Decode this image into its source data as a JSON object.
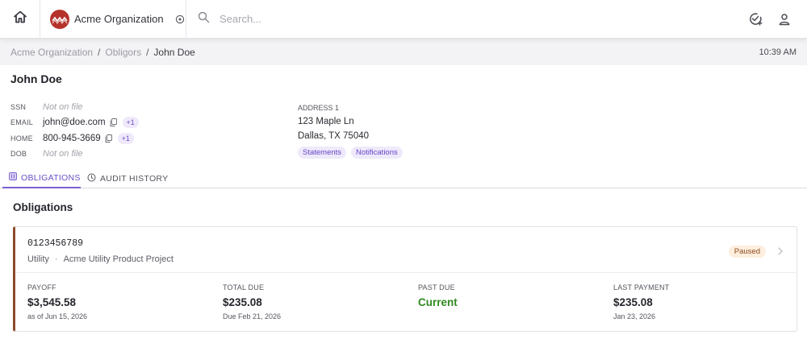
{
  "header": {
    "org_name": "Acme Organization",
    "search_placeholder": "Search...",
    "icons": {
      "home": "home-icon",
      "org_logo": "acme-logo",
      "org_switch": "switch-org-icon",
      "search": "search-icon",
      "tasks": "check-plus-icon",
      "user": "user-icon"
    }
  },
  "breadcrumb": {
    "items": [
      "Acme Organization",
      "Obligors"
    ],
    "current": "John Doe",
    "separator": "/"
  },
  "clock": "10:39 AM",
  "person": {
    "name": "John Doe",
    "ssn": {
      "label": "SSN",
      "value": "Not on file"
    },
    "email": {
      "label": "EMAIL",
      "value": "john@doe.com",
      "extra": "+1"
    },
    "home": {
      "label": "HOME",
      "value": "800-945-3669",
      "extra": "+1"
    },
    "dob": {
      "label": "DOB",
      "value": "Not on file"
    },
    "address": {
      "label": "ADDRESS 1",
      "line1": "123 Maple Ln",
      "line2": "Dallas, TX 75040",
      "tags": [
        "Statements",
        "Notifications"
      ]
    }
  },
  "tabs": [
    {
      "label": "OBLIGATIONS",
      "active": true,
      "icon": "obligations-icon"
    },
    {
      "label": "AUDIT HISTORY",
      "active": false,
      "icon": "clock-icon"
    }
  ],
  "obligations": {
    "title": "Obligations",
    "items": [
      {
        "account_number": "0123456789",
        "type": "Utility",
        "project": "Acme Utility Product Project",
        "status": "Paused",
        "metrics": [
          {
            "label": "PAYOFF",
            "value": "$3,545.58",
            "sub": "as of Jun 15, 2026"
          },
          {
            "label": "TOTAL DUE",
            "value": "$235.08",
            "sub": "Due Feb 21, 2026"
          },
          {
            "label": "PAST DUE",
            "value": "Current",
            "sub": ""
          },
          {
            "label": "LAST PAYMENT",
            "value": "$235.08",
            "sub": "Jan 23, 2026"
          }
        ]
      }
    ]
  },
  "colors": {
    "accent": "#7b61d1",
    "brand_logo": "#b5322b",
    "card_stripe": "#8c4a2b",
    "status_paused_bg": "#fdeede",
    "current_green": "#2f8a1f"
  }
}
